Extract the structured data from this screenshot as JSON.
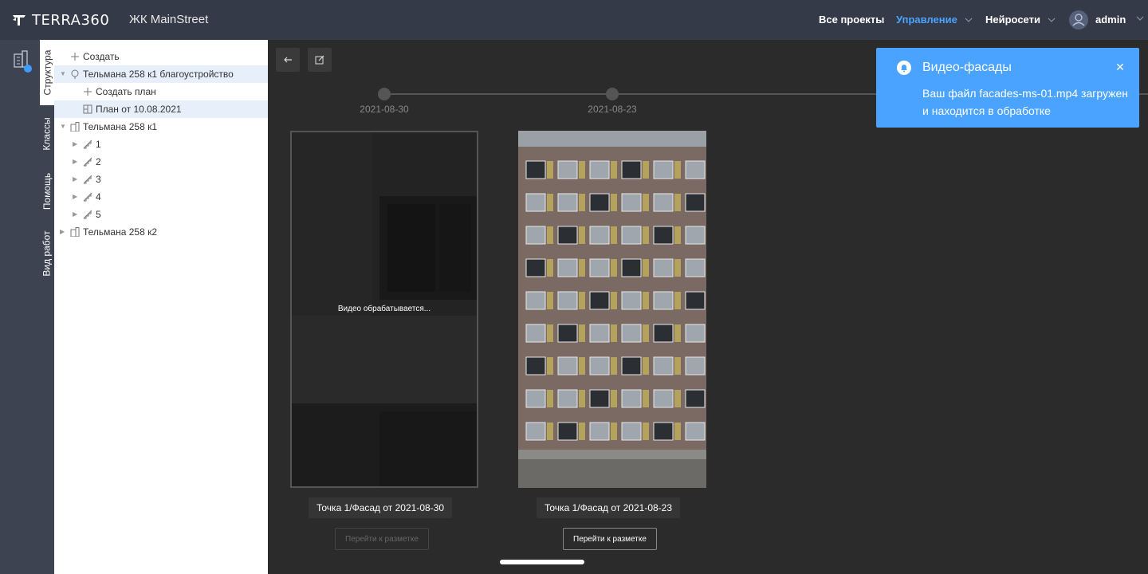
{
  "header": {
    "logo_text": "TERRA360",
    "project_name": "ЖК MainStreet",
    "nav": [
      {
        "label": "Все проекты"
      },
      {
        "label": "Управление"
      },
      {
        "label": "Нейросети"
      }
    ],
    "user": "admin"
  },
  "vtabs": [
    "Структура",
    "Классы",
    "Помощь",
    "Вид работ"
  ],
  "tree": [
    {
      "label": "Создать",
      "icon": "plus-icon"
    },
    {
      "label": "Тельмана 258 к1 благоустройство",
      "icon": "tree-icon"
    },
    {
      "label": "Создать план",
      "icon": "plus-icon"
    },
    {
      "label": "План от 10.08.2021",
      "icon": "plan-icon"
    },
    {
      "label": "Тельмана 258 к1",
      "icon": "building-icon"
    },
    {
      "label": "1",
      "icon": "stairs-icon"
    },
    {
      "label": "2",
      "icon": "stairs-icon"
    },
    {
      "label": "3",
      "icon": "stairs-icon"
    },
    {
      "label": "4",
      "icon": "stairs-icon"
    },
    {
      "label": "5",
      "icon": "stairs-icon"
    },
    {
      "label": "Тельмана 258 к2",
      "icon": "building-icon"
    }
  ],
  "timeline": {
    "dates": [
      "2021-08-30",
      "2021-08-23"
    ]
  },
  "cards": [
    {
      "status_text": "Видео обрабатывается...",
      "caption": "Точка 1/Фасад от 2021-08-30",
      "button": "Перейти к разметке",
      "button_enabled": false
    },
    {
      "caption": "Точка 1/Фасад от 2021-08-23",
      "button": "Перейти к разметке",
      "button_enabled": true
    }
  ],
  "toast": {
    "title": "Видео-фасады",
    "body": "Ваш файл facades-ms-01.mp4 загружен и находится в обработке",
    "color": "#4aa3ff"
  },
  "colors": {
    "header_bg": "#353a48",
    "accent": "#4aa3ff",
    "main_bg": "#2b2b2b"
  }
}
